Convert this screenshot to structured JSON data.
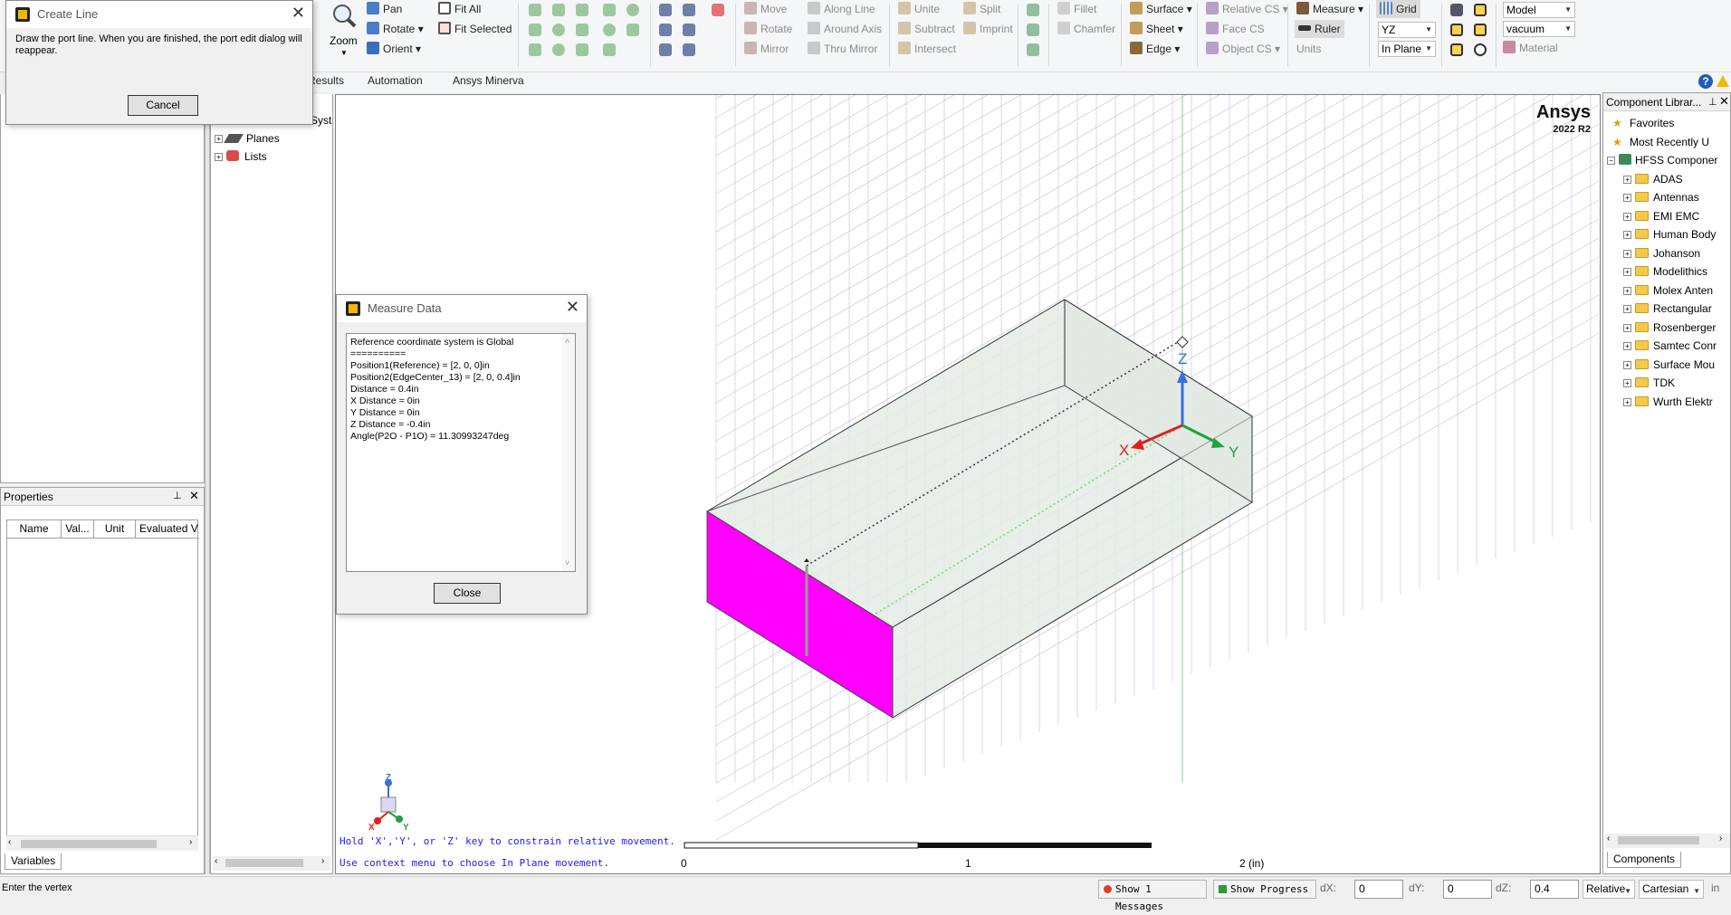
{
  "ribbon": {
    "zoom_group": {
      "pan": "Pan",
      "rotate": "Rotate",
      "orient": "Orient",
      "zoom": "Zoom",
      "fit_all": "Fit All",
      "fit_selected": "Fit Selected"
    },
    "modify": {
      "move": "Move",
      "rotate": "Rotate",
      "mirror": "Mirror",
      "along_line": "Along Line",
      "around_axis": "Around Axis",
      "thru_mirror": "Thru Mirror"
    },
    "boolean": {
      "unite": "Unite",
      "subtract": "Subtract",
      "intersect": "Intersect",
      "split": "Split",
      "imprint": "Imprint"
    },
    "edges": {
      "fillet": "Fillet",
      "chamfer": "Chamfer"
    },
    "select": {
      "surface": "Surface",
      "sheet": "Sheet",
      "edge": "Edge"
    },
    "cs": {
      "relative_cs": "Relative CS",
      "face_cs": "Face CS",
      "object_cs": "Object CS"
    },
    "measure": {
      "measure": "Measure",
      "ruler": "Ruler",
      "units": "Units"
    },
    "grid": {
      "grid": "Grid",
      "plane": "YZ",
      "mode": "In Plane"
    },
    "model": {
      "model": "Model",
      "material_value": "vacuum",
      "material": "Material"
    }
  },
  "tabs": [
    "Results",
    "Automation",
    "Ansys Minerva"
  ],
  "create_line_dialog": {
    "title": "Create Line",
    "message": "Draw the port line.  When you are finished, the port edit dialog will reappear.",
    "cancel": "Cancel"
  },
  "tree": {
    "partial_label": "Syst",
    "items": [
      {
        "label": "Planes"
      },
      {
        "label": "Lists"
      }
    ]
  },
  "properties": {
    "title": "Properties",
    "columns": [
      "Name",
      "Val...",
      "Unit",
      "Evaluated V"
    ],
    "footer_tab": "Variables"
  },
  "measure_dialog": {
    "title": "Measure Data",
    "lines": [
      "Reference coordinate system is Global",
      "==========",
      "Position1(Reference) = [2, 0, 0]in",
      "Position2(EdgeCenter_13) = [2, 0, 0.4]in",
      "Distance = 0.4in",
      "X Distance = 0in",
      "Y Distance = 0in",
      "Z Distance = -0.4in",
      "Angle(P2O - P1O) = 11.30993247deg"
    ],
    "close": "Close"
  },
  "viewport": {
    "brand": "Ansys",
    "version": "2022 R2",
    "hint1": "Hold 'X','Y', or 'Z' key to constrain relative movement.",
    "hint2": "Use context menu to choose In Plane movement.",
    "scale_labels": [
      "0",
      "1",
      "2 (in)"
    ],
    "axis_labels": {
      "x": "X",
      "y": "Y",
      "z": "Z"
    },
    "colors": {
      "port_face": "#ff00ff",
      "box_fill": "#e8efe8",
      "grid": "#c8c8e0"
    }
  },
  "component_library": {
    "title": "Component Librar...",
    "items": [
      {
        "label": "Favorites"
      },
      {
        "label": "Most Recently U"
      },
      {
        "label": "HFSS Componer"
      },
      {
        "label": "ADAS"
      },
      {
        "label": "Antennas"
      },
      {
        "label": "EMI EMC"
      },
      {
        "label": "Human Body"
      },
      {
        "label": "Johanson"
      },
      {
        "label": "Modelithics"
      },
      {
        "label": "Molex Anten"
      },
      {
        "label": "Rectangular"
      },
      {
        "label": "Rosenberger"
      },
      {
        "label": "Samtec Conr"
      },
      {
        "label": "Surface Mou"
      },
      {
        "label": "TDK"
      },
      {
        "label": "Wurth Elektr"
      }
    ],
    "footer_tab": "Components"
  },
  "statusbar": {
    "prompt": "Enter the vertex",
    "show_messages": "Show 1 Messages",
    "show_progress": "Show Progress",
    "dx_label": "dX:",
    "dx": "0",
    "dy_label": "dY:",
    "dy": "0",
    "dz_label": "dZ:",
    "dz": "0.4",
    "mode": "Relative",
    "coord": "Cartesian",
    "unit": "in"
  }
}
